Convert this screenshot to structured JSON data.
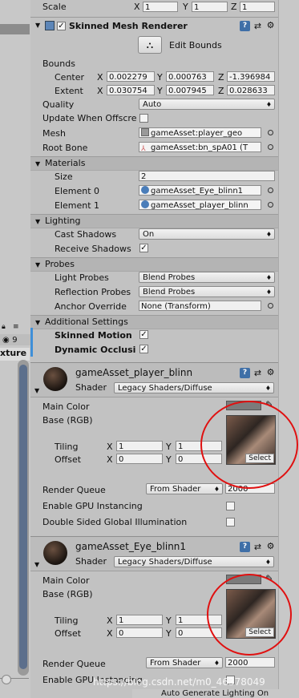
{
  "transform": {
    "scale_label": "Scale",
    "x_label": "X",
    "x": "1",
    "y_label": "Y",
    "y": "1",
    "z_label": "Z",
    "z": "1"
  },
  "renderer": {
    "title": "Skinned Mesh Renderer",
    "edit_bounds": "Edit Bounds",
    "bounds_label": "Bounds",
    "center_label": "Center",
    "center": {
      "x": "0.002279",
      "y": "0.000763",
      "z": "-1.396984"
    },
    "extent_label": "Extent",
    "extent": {
      "x": "0.030754",
      "y": "0.007945",
      "z": "0.028633"
    },
    "quality_label": "Quality",
    "quality": "Auto",
    "update_offscreen_label": "Update When Offscre",
    "mesh_label": "Mesh",
    "mesh": "gameAsset:player_geo",
    "root_bone_label": "Root Bone",
    "root_bone": "gameAsset:bn_spA01 (T",
    "materials_label": "Materials",
    "size_label": "Size",
    "size": "2",
    "element0_label": "Element 0",
    "element0": "gameAsset_Eye_blinn1",
    "element1_label": "Element 1",
    "element1": "gameAsset_player_blinn",
    "lighting_label": "Lighting",
    "cast_shadows_label": "Cast Shadows",
    "cast_shadows": "On",
    "receive_shadows_label": "Receive Shadows",
    "probes_label": "Probes",
    "light_probes_label": "Light Probes",
    "light_probes": "Blend Probes",
    "reflection_probes_label": "Reflection Probes",
    "reflection_probes": "Blend Probes",
    "anchor_override_label": "Anchor Override",
    "anchor_override": "None (Transform)",
    "additional_label": "Additional Settings",
    "skinned_motion_label": "Skinned Motion",
    "dynamic_occlusion_label": "Dynamic Occlusi"
  },
  "material1": {
    "name": "gameAsset_player_blinn",
    "shader_label": "Shader",
    "shader": "Legacy Shaders/Diffuse",
    "main_color_label": "Main Color",
    "base_label": "Base (RGB)",
    "tiling_label": "Tiling",
    "offset_label": "Offset",
    "tiling": {
      "x": "1",
      "y": "1"
    },
    "offset": {
      "x": "0",
      "y": "0"
    },
    "select_label": "Select",
    "render_queue_label": "Render Queue",
    "render_queue_mode": "From Shader",
    "render_queue": "2000",
    "gpu_instancing_label": "Enable GPU Instancing",
    "double_sided_label": "Double Sided Global Illumination"
  },
  "material2": {
    "name": "gameAsset_Eye_blinn1",
    "shader_label": "Shader",
    "shader": "Legacy Shaders/Diffuse",
    "main_color_label": "Main Color",
    "base_label": "Base (RGB)",
    "tiling_label": "Tiling",
    "offset_label": "Offset",
    "tiling": {
      "x": "1",
      "y": "1"
    },
    "offset": {
      "x": "0",
      "y": "0"
    },
    "select_label": "Select",
    "render_queue_label": "Render Queue",
    "render_queue_mode": "From Shader",
    "render_queue": "2000",
    "gpu_instancing_label": "Enable GPU Instancing"
  },
  "left": {
    "eye_count": "9",
    "texture_tab": "xture"
  },
  "footer": {
    "watermark": "https://blog.csdn.net/m0_46378049",
    "autogen": "Auto Generate Lighting On"
  },
  "axis": {
    "x": "X",
    "y": "Y",
    "z": "Z"
  },
  "icons": {
    "check": "✓",
    "arrow": "♦",
    "help": "?",
    "settings": "⚙",
    "preset": "⇄"
  },
  "colors": {
    "annotation_red": "#e01010",
    "toggle_blue": "#3f6fa7"
  }
}
